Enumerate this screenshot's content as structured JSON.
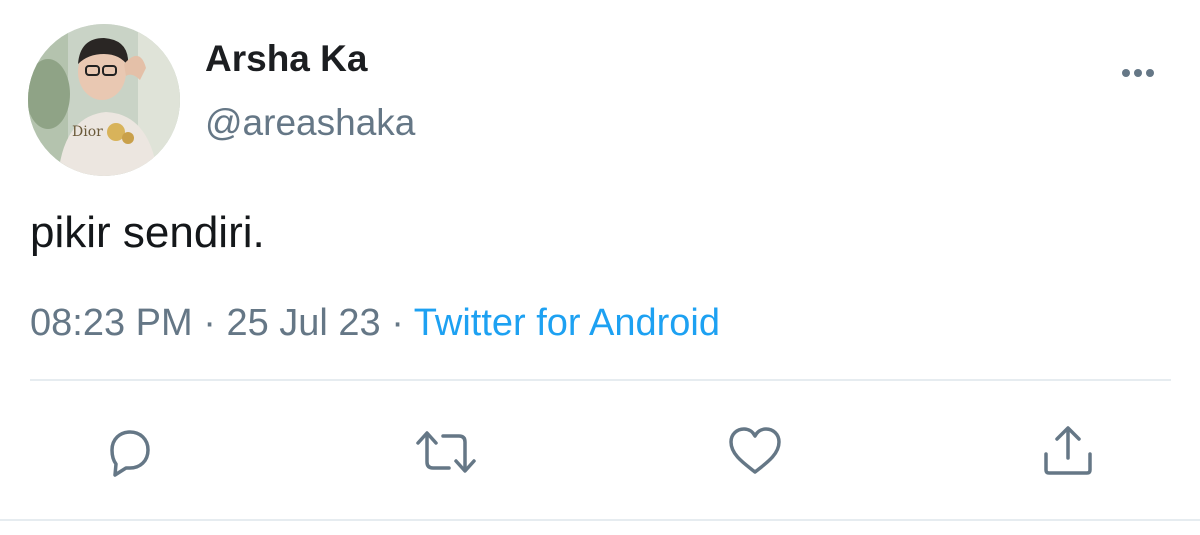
{
  "tweet": {
    "author": {
      "name": "Arsha Ka",
      "handle": "@areashaka"
    },
    "text": "pikir sendiri.",
    "time": "08:23 PM",
    "separator": "·",
    "date": "25 Jul 23",
    "source": "Twitter for Android"
  },
  "icons": {
    "more": "more-horizontal-icon",
    "reply": "reply-icon",
    "retweet": "retweet-icon",
    "like": "heart-icon",
    "share": "share-icon"
  },
  "colors": {
    "text": "#14171a",
    "secondary": "#657786",
    "link": "#1da1f2",
    "divider": "#e6ecf0",
    "icon": "#657786"
  }
}
